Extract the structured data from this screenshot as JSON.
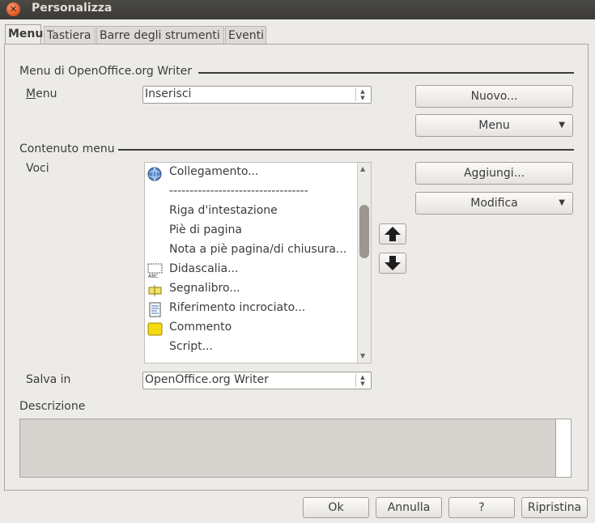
{
  "window": {
    "title": "Personalizza"
  },
  "tabs": [
    {
      "label": "Menu",
      "active": true
    },
    {
      "label": "Tastiera"
    },
    {
      "label": "Barre degli strumenti"
    },
    {
      "label": "Eventi"
    }
  ],
  "menu_section": {
    "title": "Menu di OpenOffice.org Writer",
    "menu_label": "Menu",
    "menu_value": "Inserisci",
    "new_button": "Nuovo...",
    "menu_button": "Menu"
  },
  "content_section": {
    "title": "Contenuto menu",
    "entries_label": "Voci",
    "add_button": "Aggiungi...",
    "modify_button": "Modifica",
    "items": [
      {
        "label": "Collegamento...",
        "icon": "globe-link-icon"
      },
      {
        "label": "----------------------------------"
      },
      {
        "label": "Riga d'intestazione"
      },
      {
        "label": "Piè di pagina"
      },
      {
        "label": "Nota a piè pagina/di chiusura..."
      },
      {
        "label": "Didascalia...",
        "icon": "caption-icon"
      },
      {
        "label": "Segnalibro...",
        "icon": "bookmark-icon"
      },
      {
        "label": "Riferimento incrociato...",
        "icon": "cross-reference-icon"
      },
      {
        "label": "Commento",
        "icon": "comment-icon"
      },
      {
        "label": "Script..."
      }
    ]
  },
  "save_in": {
    "label": "Salva in",
    "value": "OpenOffice.org Writer"
  },
  "description": {
    "label": "Descrizione"
  },
  "footer": {
    "ok": "Ok",
    "cancel": "Annulla",
    "help": "?",
    "reset": "Ripristina"
  }
}
